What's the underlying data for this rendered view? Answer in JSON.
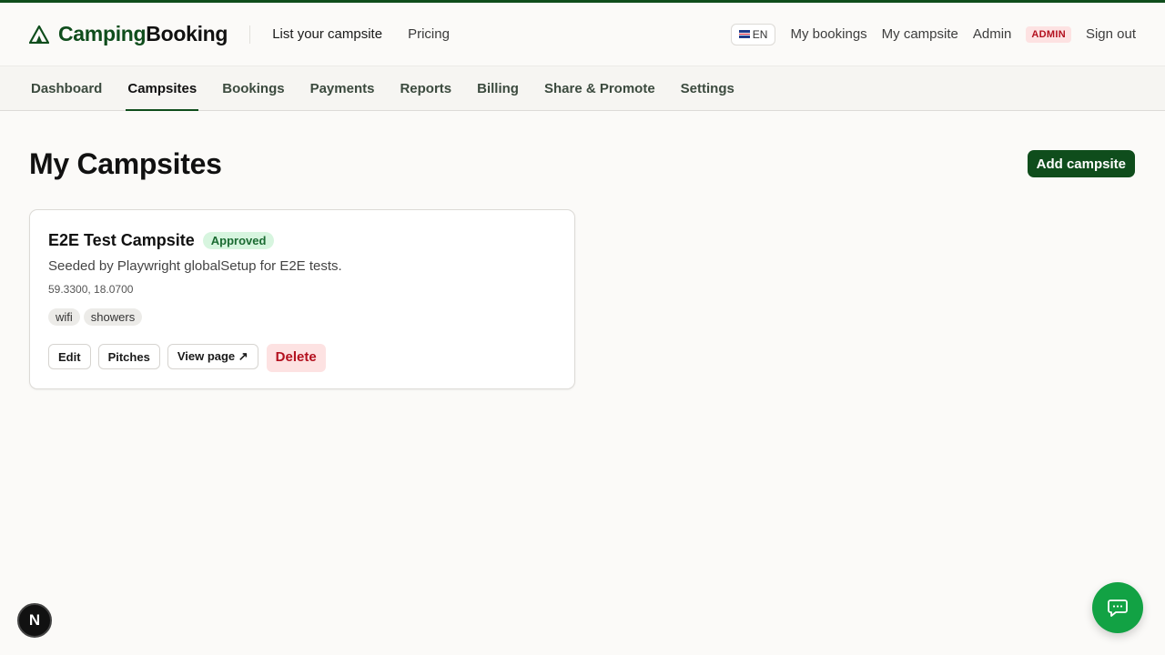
{
  "brand": {
    "part1": "Camping",
    "part2": "Booking",
    "icon": "tent-icon"
  },
  "header": {
    "links": [
      "List your campsite",
      "Pricing"
    ],
    "language": "EN",
    "right_links": [
      "My bookings",
      "My campsite",
      "Admin"
    ],
    "role_badge": "ADMIN",
    "sign_out": "Sign out"
  },
  "tabs": [
    "Dashboard",
    "Campsites",
    "Bookings",
    "Payments",
    "Reports",
    "Billing",
    "Share & Promote",
    "Settings"
  ],
  "active_tab": "Campsites",
  "page": {
    "title": "My Campsites",
    "add_button": "Add campsite"
  },
  "campsite": {
    "name": "E2E Test Campsite",
    "status": "Approved",
    "description": "Seeded by Playwright globalSetup for E2E tests.",
    "coordinates": "59.3300, 18.0700",
    "amenities": [
      "wifi",
      "showers"
    ],
    "actions": {
      "edit": "Edit",
      "pitches": "Pitches",
      "view": "View page ↗",
      "delete": "Delete"
    }
  },
  "dev_badge": "N",
  "chat_icon": "chat-icon",
  "colors": {
    "brand": "#0f4d1c",
    "chat": "#12a244",
    "danger": "#b3101e",
    "approved": "#1b6b32"
  }
}
